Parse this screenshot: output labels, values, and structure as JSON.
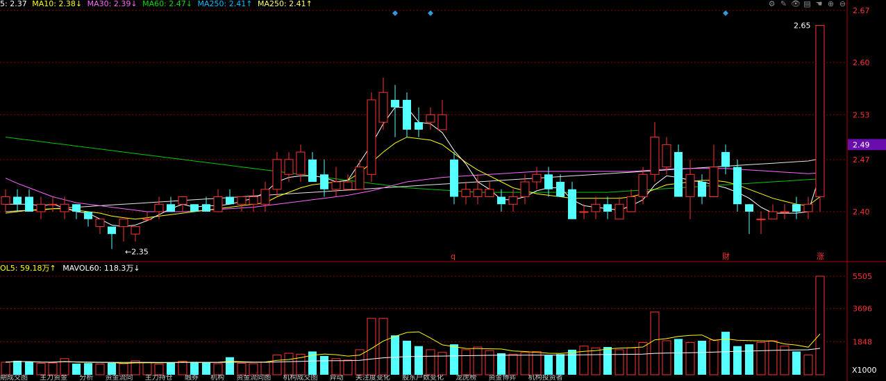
{
  "ma_header": [
    {
      "text": "5: 2.37",
      "color": "#ffffff"
    },
    {
      "text": "MA10: 2.38↓",
      "color": "#ffff00"
    },
    {
      "text": "MA30: 2.39↓",
      "color": "#ff66ff"
    },
    {
      "text": "MA60: 2.47↓",
      "color": "#00dd00"
    },
    {
      "text": "MA250: 2.41↑",
      "color": "#00bfff"
    },
    {
      "text": "MA250: 2.41↑",
      "color": "#ffff66"
    }
  ],
  "vol_header": [
    {
      "text": "OL5: 59.18万↑",
      "color": "#ffff00"
    },
    {
      "text": "MAVOL60: 118.3万↓",
      "color": "#ffffff"
    }
  ],
  "toolbar_icons": [
    "gear-icon",
    "pen-icon",
    "eye-icon",
    "book-icon",
    "hand-icon",
    "plus-circle-icon",
    "minus-circle-icon"
  ],
  "price_axis": {
    "ticks": [
      "2.67",
      "2.60",
      "2.53",
      "2.47",
      "2.40"
    ],
    "current": "2.49",
    "min": 2.35,
    "max": 2.67
  },
  "volume_axis": {
    "ticks": [
      "5505",
      "3696",
      "1848"
    ],
    "unit": "X1000"
  },
  "annotations": {
    "high_label": "2.65",
    "low_label": "2.35",
    "markers": [
      "q",
      "财",
      "涨"
    ]
  },
  "colors": {
    "up": "#ff3232",
    "down": "#54ffff",
    "grid": "#8b0000",
    "current_price_bg": "#6a0dad"
  },
  "footer_labels": [
    "期成交图",
    "主力资金",
    "分析",
    "资金流向",
    "主力持仓",
    "融券",
    "机构",
    "资金流向图",
    "机构成交图",
    "异动",
    "关注度变化",
    "股东户数变化",
    "龙虎榜",
    "资金博弈",
    "机构投资者"
  ],
  "chart_data": {
    "type": "candlestick",
    "title": "",
    "ylim": [
      2.35,
      2.67
    ],
    "candles": [
      [
        2.41,
        2.42,
        2.43,
        2.4
      ],
      [
        2.42,
        2.41,
        2.43,
        2.4
      ],
      [
        2.42,
        2.4,
        2.43,
        2.4
      ],
      [
        2.4,
        2.41,
        2.42,
        2.39
      ],
      [
        2.41,
        2.41,
        2.42,
        2.4
      ],
      [
        2.4,
        2.41,
        2.42,
        2.39
      ],
      [
        2.41,
        2.4,
        2.41,
        2.39
      ],
      [
        2.4,
        2.39,
        2.4,
        2.38
      ],
      [
        2.38,
        2.39,
        2.39,
        2.37
      ],
      [
        2.38,
        2.37,
        2.38,
        2.35
      ],
      [
        2.38,
        2.39,
        2.39,
        2.36
      ],
      [
        2.37,
        2.38,
        2.38,
        2.36
      ],
      [
        2.39,
        2.39,
        2.4,
        2.39
      ],
      [
        2.4,
        2.41,
        2.42,
        2.39
      ],
      [
        2.41,
        2.4,
        2.42,
        2.4
      ],
      [
        2.41,
        2.42,
        2.42,
        2.4
      ],
      [
        2.41,
        2.4,
        2.41,
        2.4
      ],
      [
        2.41,
        2.4,
        2.42,
        2.4
      ],
      [
        2.4,
        2.42,
        2.43,
        2.4
      ],
      [
        2.42,
        2.41,
        2.43,
        2.41
      ],
      [
        2.41,
        2.42,
        2.42,
        2.4
      ],
      [
        2.41,
        2.42,
        2.43,
        2.4
      ],
      [
        2.41,
        2.43,
        2.44,
        2.4
      ],
      [
        2.43,
        2.47,
        2.48,
        2.42
      ],
      [
        2.45,
        2.47,
        2.48,
        2.44
      ],
      [
        2.45,
        2.48,
        2.49,
        2.44
      ],
      [
        2.47,
        2.44,
        2.48,
        2.44
      ],
      [
        2.45,
        2.43,
        2.47,
        2.42
      ],
      [
        2.43,
        2.44,
        2.46,
        2.42
      ],
      [
        2.43,
        2.44,
        2.45,
        2.43
      ],
      [
        2.43,
        2.46,
        2.47,
        2.43
      ],
      [
        2.45,
        2.55,
        2.56,
        2.44
      ],
      [
        2.52,
        2.56,
        2.58,
        2.51
      ],
      [
        2.55,
        2.54,
        2.57,
        2.5
      ],
      [
        2.55,
        2.51,
        2.56,
        2.5
      ],
      [
        2.52,
        2.51,
        2.54,
        2.5
      ],
      [
        2.52,
        2.53,
        2.54,
        2.51
      ],
      [
        2.51,
        2.53,
        2.55,
        2.52
      ],
      [
        2.47,
        2.42,
        2.48,
        2.41
      ],
      [
        2.42,
        2.43,
        2.44,
        2.41
      ],
      [
        2.42,
        2.43,
        2.45,
        2.41
      ],
      [
        2.42,
        2.43,
        2.44,
        2.42
      ],
      [
        2.42,
        2.41,
        2.43,
        2.4
      ],
      [
        2.41,
        2.42,
        2.43,
        2.4
      ],
      [
        2.42,
        2.44,
        2.45,
        2.41
      ],
      [
        2.44,
        2.45,
        2.46,
        2.43
      ],
      [
        2.45,
        2.43,
        2.46,
        2.42
      ],
      [
        2.44,
        2.42,
        2.45,
        2.42
      ],
      [
        2.43,
        2.39,
        2.44,
        2.39
      ],
      [
        2.4,
        2.4,
        2.41,
        2.39
      ],
      [
        2.4,
        2.41,
        2.42,
        2.39
      ],
      [
        2.41,
        2.4,
        2.42,
        2.39
      ],
      [
        2.39,
        2.41,
        2.42,
        2.39
      ],
      [
        2.4,
        2.42,
        2.43,
        2.4
      ],
      [
        2.42,
        2.45,
        2.46,
        2.41
      ],
      [
        2.45,
        2.5,
        2.52,
        2.44
      ],
      [
        2.46,
        2.49,
        2.5,
        2.45
      ],
      [
        2.48,
        2.42,
        2.49,
        2.42
      ],
      [
        2.42,
        2.45,
        2.47,
        2.39
      ],
      [
        2.44,
        2.42,
        2.45,
        2.41
      ],
      [
        2.42,
        2.46,
        2.49,
        2.42
      ],
      [
        2.48,
        2.46,
        2.49,
        2.45
      ],
      [
        2.46,
        2.41,
        2.47,
        2.4
      ],
      [
        2.41,
        2.4,
        2.41,
        2.37
      ],
      [
        2.39,
        2.39,
        2.4,
        2.37
      ],
      [
        2.39,
        2.4,
        2.41,
        2.39
      ],
      [
        2.4,
        2.4,
        2.41,
        2.39
      ],
      [
        2.41,
        2.4,
        2.42,
        2.39
      ],
      [
        2.4,
        2.41,
        2.42,
        2.39
      ],
      [
        2.42,
        2.65,
        2.65,
        2.4
      ]
    ],
    "volume": [
      700,
      780,
      720,
      640,
      660,
      900,
      620,
      650,
      600,
      660,
      620,
      780,
      680,
      600,
      700,
      760,
      720,
      680,
      620,
      980,
      640,
      620,
      700,
      1100,
      1200,
      1150,
      1300,
      1050,
      900,
      820,
      1400,
      3150,
      3150,
      2200,
      1900,
      1600,
      1400,
      1250,
      1700,
      1400,
      1550,
      1350,
      1200,
      1150,
      1250,
      1300,
      1100,
      1150,
      1400,
      1600,
      1500,
      1550,
      1400,
      1500,
      1800,
      3500,
      1900,
      2000,
      1800,
      1900,
      1950,
      2400,
      1600,
      1700,
      1800,
      1900,
      1600,
      1300,
      1100,
      5505
    ],
    "ma5": [
      2.41,
      2.41,
      2.41,
      2.408,
      2.41,
      2.405,
      2.4,
      2.398,
      2.39,
      2.382,
      2.38,
      2.382,
      2.388,
      2.396,
      2.404,
      2.41,
      2.406,
      2.408,
      2.408,
      2.41,
      2.414,
      2.418,
      2.426,
      2.44,
      2.446,
      2.448,
      2.448,
      2.446,
      2.44,
      2.442,
      2.466,
      2.49,
      2.518,
      2.54,
      2.54,
      2.52,
      2.518,
      2.506,
      2.482,
      2.464,
      2.44,
      2.43,
      2.416,
      2.416,
      2.42,
      2.428,
      2.432,
      2.432,
      2.416,
      2.408,
      2.406,
      2.404,
      2.402,
      2.408,
      2.416,
      2.436,
      2.448,
      2.446,
      2.442,
      2.44,
      2.436,
      2.432,
      2.426,
      2.418,
      2.406,
      2.398,
      2.398,
      2.398,
      2.4,
      2.45
    ],
    "ma10": [
      2.398,
      2.4,
      2.402,
      2.402,
      2.404,
      2.404,
      2.402,
      2.4,
      2.398,
      2.394,
      2.392,
      2.39,
      2.392,
      2.394,
      2.396,
      2.398,
      2.4,
      2.402,
      2.404,
      2.406,
      2.408,
      2.41,
      2.412,
      2.42,
      2.426,
      2.432,
      2.436,
      2.438,
      2.44,
      2.442,
      2.452,
      2.466,
      2.48,
      2.492,
      2.5,
      2.498,
      2.496,
      2.49,
      2.478,
      2.466,
      2.456,
      2.448,
      2.44,
      2.432,
      2.428,
      2.424,
      2.422,
      2.42,
      2.418,
      2.418,
      2.418,
      2.418,
      2.418,
      2.42,
      2.424,
      2.43,
      2.436,
      2.438,
      2.44,
      2.442,
      2.442,
      2.44,
      2.436,
      2.43,
      2.424,
      2.418,
      2.414,
      2.41,
      2.408,
      2.42
    ],
    "ma30": [
      2.445,
      2.438,
      2.432,
      2.426,
      2.42,
      2.416,
      2.412,
      2.41,
      2.408,
      2.406,
      2.404,
      2.402,
      2.4,
      2.4,
      2.4,
      2.4,
      2.401,
      2.402,
      2.403,
      2.404,
      2.405,
      2.406,
      2.408,
      2.41,
      2.412,
      2.414,
      2.416,
      2.418,
      2.42,
      2.422,
      2.425,
      2.428,
      2.432,
      2.436,
      2.44,
      2.442,
      2.444,
      2.446,
      2.447,
      2.448,
      2.449,
      2.45,
      2.451,
      2.452,
      2.453,
      2.454,
      2.454,
      2.454,
      2.454,
      2.454,
      2.454,
      2.454,
      2.454,
      2.454,
      2.455,
      2.456,
      2.457,
      2.458,
      2.458,
      2.458,
      2.458,
      2.458,
      2.457,
      2.456,
      2.455,
      2.454,
      2.453,
      2.452,
      2.451,
      2.452
    ],
    "ma60": [
      2.5,
      2.498,
      2.496,
      2.494,
      2.492,
      2.49,
      2.488,
      2.486,
      2.484,
      2.482,
      2.48,
      2.478,
      2.476,
      2.474,
      2.472,
      2.47,
      2.468,
      2.466,
      2.464,
      2.462,
      2.46,
      2.458,
      2.456,
      2.454,
      2.452,
      2.45,
      2.448,
      2.446,
      2.444,
      2.442,
      2.44,
      2.438,
      2.436,
      2.434,
      2.432,
      2.431,
      2.43,
      2.429,
      2.428,
      2.427,
      2.426,
      2.426,
      2.426,
      2.426,
      2.426,
      2.426,
      2.426,
      2.426,
      2.426,
      2.426,
      2.426,
      2.426,
      2.427,
      2.428,
      2.429,
      2.43,
      2.431,
      2.432,
      2.433,
      2.434,
      2.435,
      2.436,
      2.437,
      2.438,
      2.439,
      2.44,
      2.441,
      2.442,
      2.443,
      2.444
    ],
    "ma250": [
      2.4,
      2.401,
      2.402,
      2.403,
      2.404,
      2.405,
      2.406,
      2.407,
      2.408,
      2.409,
      2.41,
      2.411,
      2.412,
      2.413,
      2.414,
      2.415,
      2.416,
      2.417,
      2.418,
      2.419,
      2.42,
      2.421,
      2.422,
      2.423,
      2.424,
      2.425,
      2.426,
      2.427,
      2.428,
      2.429,
      2.43,
      2.431,
      2.432,
      2.433,
      2.434,
      2.435,
      2.436,
      2.437,
      2.438,
      2.439,
      2.44,
      2.441,
      2.442,
      2.443,
      2.444,
      2.445,
      2.446,
      2.447,
      2.448,
      2.449,
      2.45,
      2.451,
      2.452,
      2.453,
      2.454,
      2.455,
      2.456,
      2.457,
      2.458,
      2.459,
      2.46,
      2.461,
      2.462,
      2.463,
      2.464,
      2.465,
      2.466,
      2.467,
      2.468,
      2.471
    ]
  }
}
